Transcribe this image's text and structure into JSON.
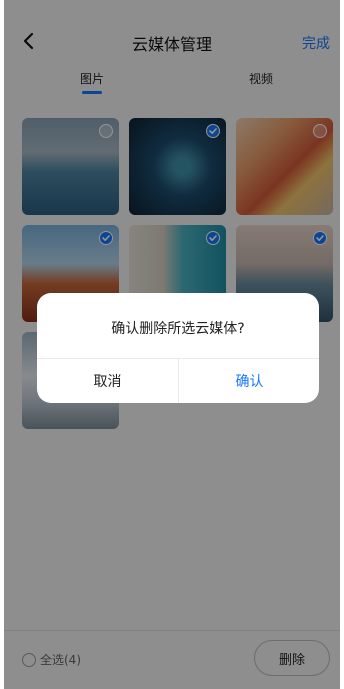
{
  "header": {
    "title": "云媒体管理",
    "done_label": "完成"
  },
  "tabs": [
    {
      "label": "图片",
      "active": true
    },
    {
      "label": "视频",
      "active": false
    }
  ],
  "media": [
    {
      "kind": "lighthouse-seaside photo",
      "selected": false
    },
    {
      "kind": "night-sky-person photo",
      "selected": true
    },
    {
      "kind": "abstract-wave art",
      "selected": false
    },
    {
      "kind": "chinese-pavilion photo",
      "selected": true
    },
    {
      "kind": "aerial-beach photo",
      "selected": true
    },
    {
      "kind": "coastline-sunset photo",
      "selected": true
    },
    {
      "kind": "snowy-landscape photo",
      "selected": false
    }
  ],
  "footer": {
    "select_all_label": "全选(4)",
    "delete_label": "删除"
  },
  "dialog": {
    "message": "确认删除所选云媒体?",
    "cancel_label": "取消",
    "confirm_label": "确认"
  },
  "colors": {
    "accent": "#1677ff",
    "background": "#f4f5f7"
  }
}
